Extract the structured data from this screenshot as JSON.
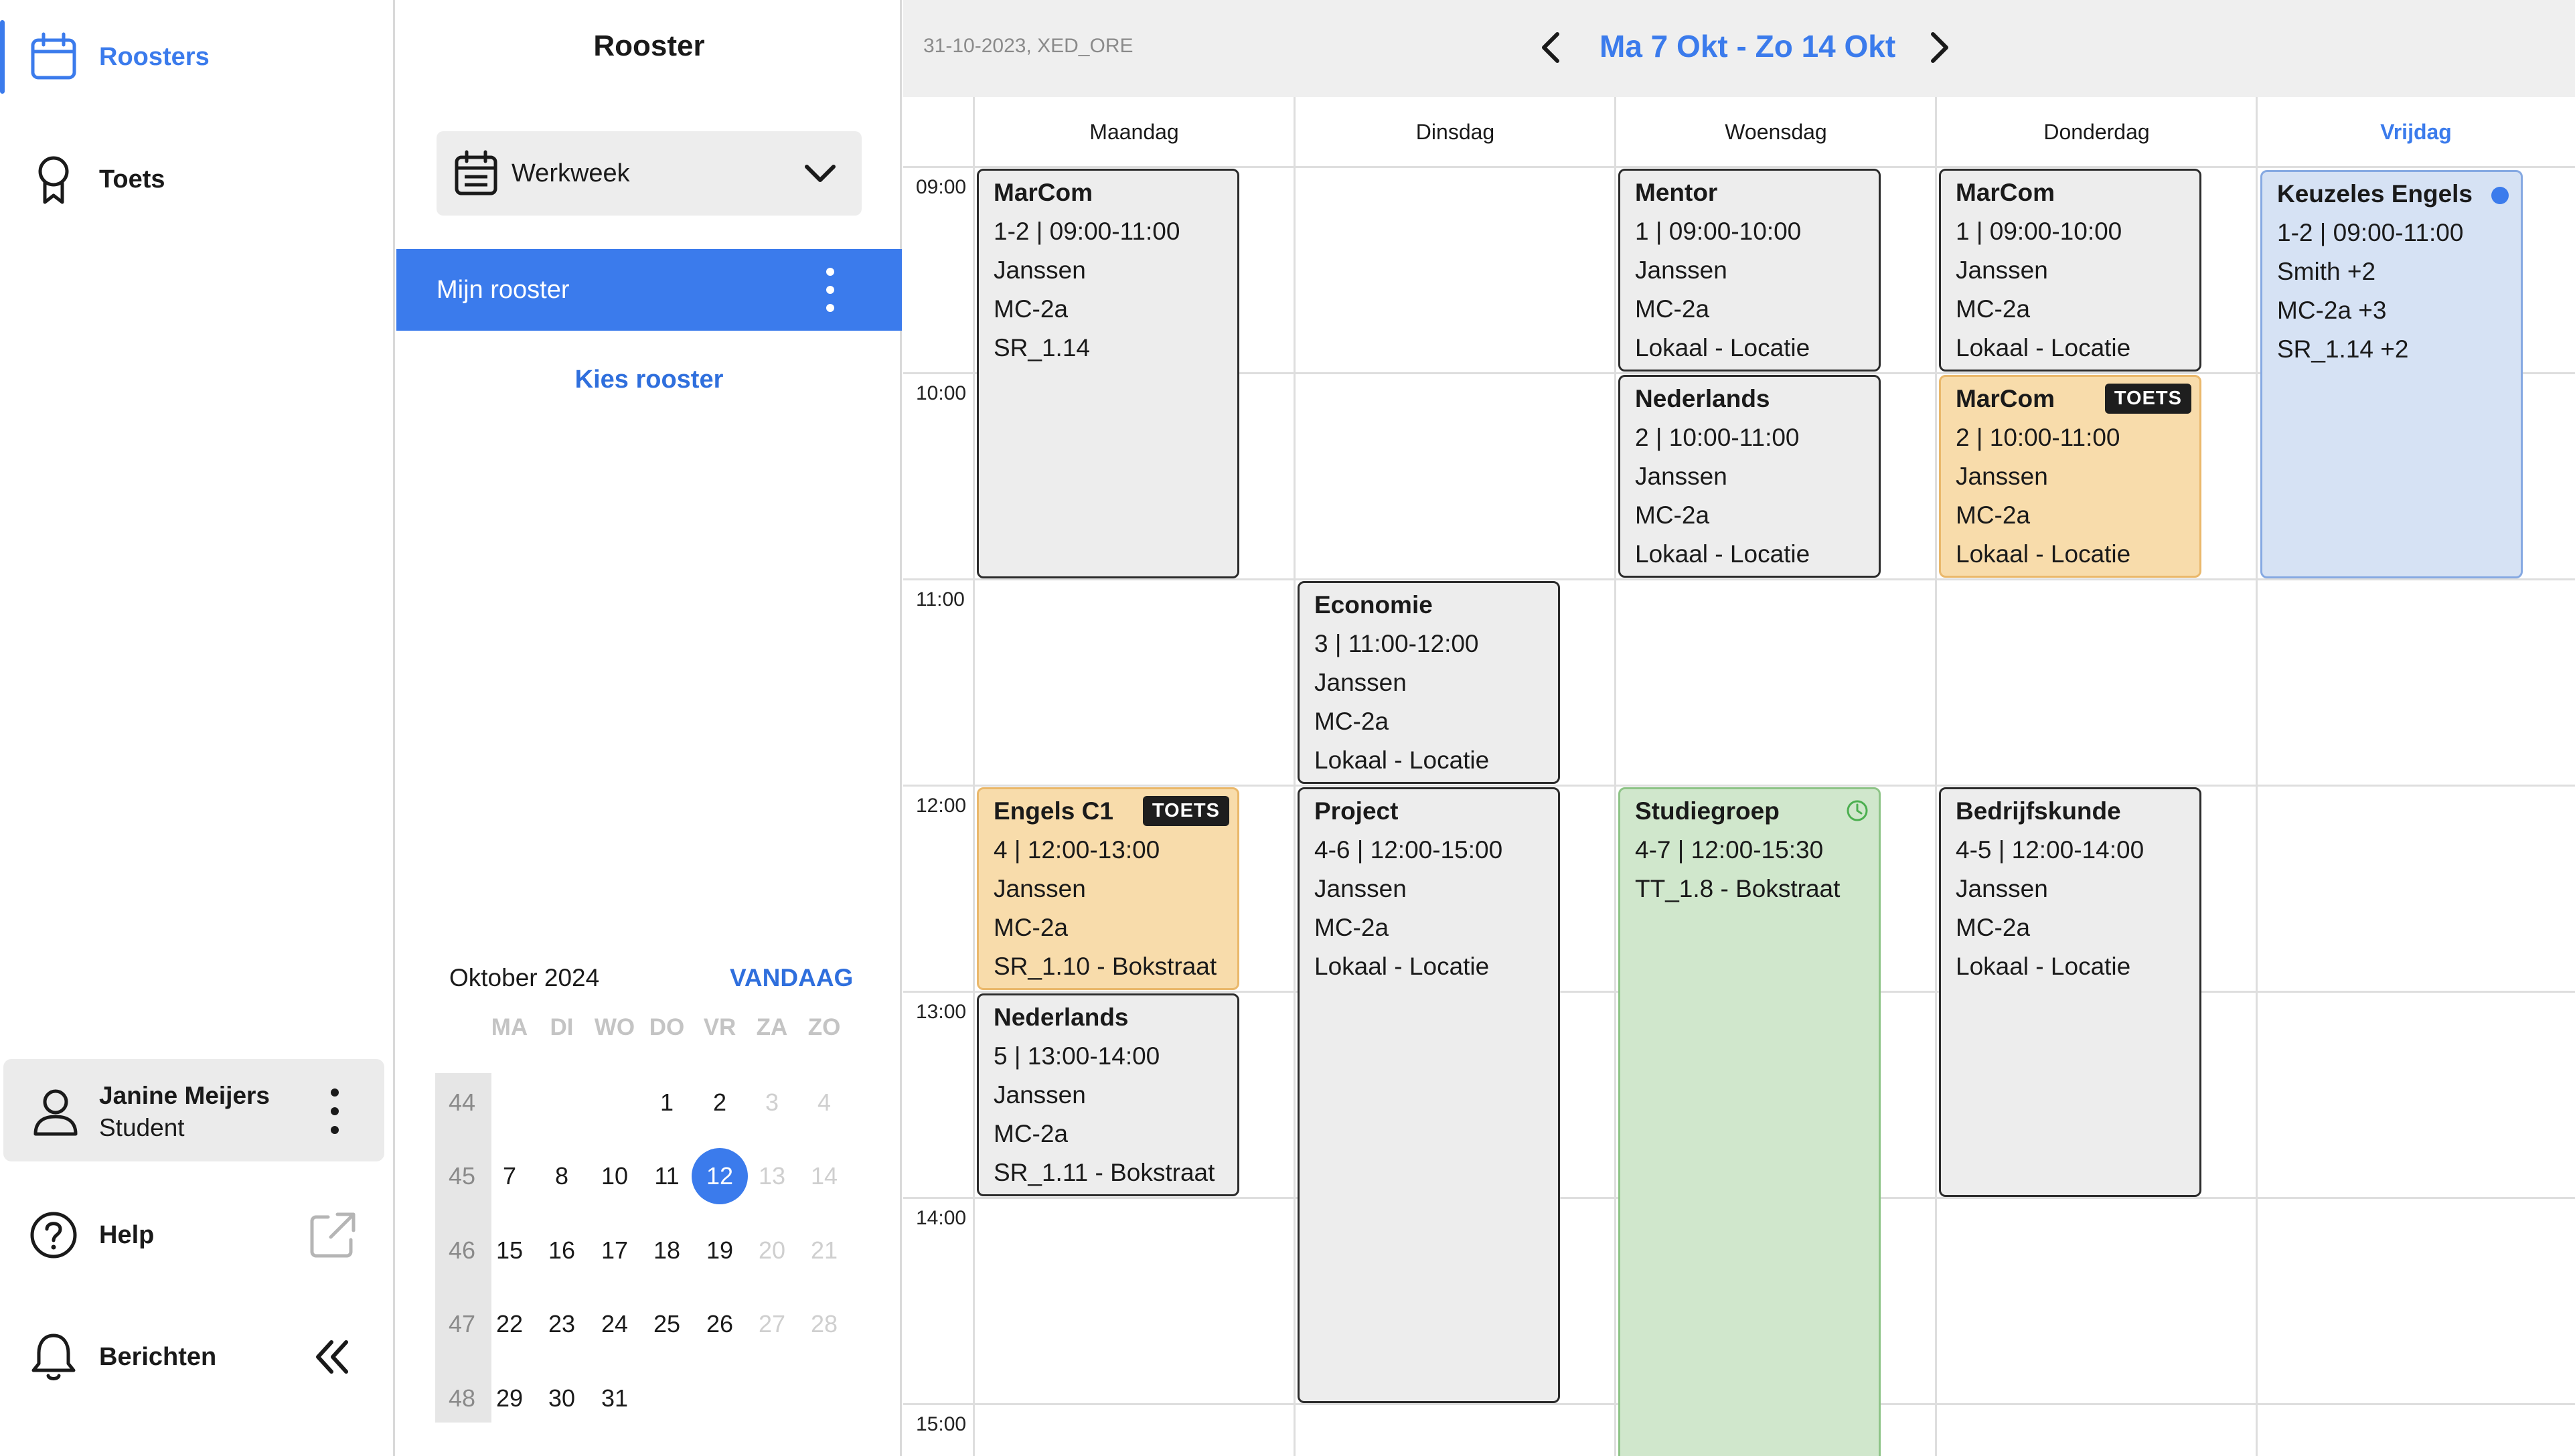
{
  "nav": {
    "roosters": "Roosters",
    "toets": "Toets",
    "user_name": "Janine Meijers",
    "user_role": "Student",
    "help": "Help",
    "berichten": "Berichten"
  },
  "panel": {
    "title": "Rooster",
    "view_select": "Werkweek",
    "my_schedule": "Mijn rooster",
    "choose_schedule": "Kies rooster"
  },
  "mini_calendar": {
    "month": "Oktober 2024",
    "today": "VANDAAG",
    "weekdays": [
      "MA",
      "DI",
      "WO",
      "DO",
      "VR",
      "ZA",
      "ZO"
    ],
    "weeks": [
      {
        "nr": "44",
        "days": [
          "",
          "",
          "",
          "1",
          "2",
          "3",
          "4"
        ]
      },
      {
        "nr": "45",
        "days": [
          "7",
          "8",
          "10",
          "11",
          "12",
          "13",
          "14"
        ]
      },
      {
        "nr": "46",
        "days": [
          "15",
          "16",
          "17",
          "18",
          "19",
          "20",
          "21"
        ]
      },
      {
        "nr": "47",
        "days": [
          "22",
          "23",
          "24",
          "25",
          "26",
          "27",
          "28"
        ]
      },
      {
        "nr": "48",
        "days": [
          "29",
          "30",
          "31",
          "",
          "",
          "",
          ""
        ]
      }
    ],
    "selected": "12"
  },
  "header": {
    "date_info": "31-10-2023, XED_ORE",
    "range": "Ma 7 Okt - Zo 14 Okt"
  },
  "days": [
    "Maandag",
    "Dinsdag",
    "Woensdag",
    "Donderdag",
    "Vrijdag"
  ],
  "times": [
    "09:00",
    "10:00",
    "11:00",
    "12:00",
    "13:00",
    "14:00",
    "15:00"
  ],
  "colors": {
    "accent": "#3b7bec",
    "toets": "#f8dcab",
    "studiegroep": "#d0e7cc",
    "keuze": "#d6e2f4",
    "default": "#ededed"
  },
  "events": {
    "mon_marcom": {
      "title": "MarCom",
      "l1": "1-2 | 09:00-11:00",
      "l2": "Janssen",
      "l3": "MC-2a",
      "l4": "SR_1.14"
    },
    "mon_engels": {
      "title": "Engels C1",
      "badge": "TOETS",
      "l1": "4 | 12:00-13:00",
      "l2": "Janssen",
      "l3": "MC-2a",
      "l4": "SR_1.10 - Bokstraat"
    },
    "mon_nederlands": {
      "title": "Nederlands",
      "l1": "5 | 13:00-14:00",
      "l2": "Janssen",
      "l3": "MC-2a",
      "l4": "SR_1.11 - Bokstraat"
    },
    "tue_economie": {
      "title": "Economie",
      "l1": "3 | 11:00-12:00",
      "l2": "Janssen",
      "l3": "MC-2a",
      "l4": "Lokaal - Locatie"
    },
    "tue_project": {
      "title": "Project",
      "l1": "4-6 | 12:00-15:00",
      "l2": "Janssen",
      "l3": "MC-2a",
      "l4": "Lokaal - Locatie"
    },
    "wed_mentor": {
      "title": "Mentor",
      "l1": "1 | 09:00-10:00",
      "l2": "Janssen",
      "l3": "MC-2a",
      "l4": "Lokaal - Locatie"
    },
    "wed_nederlands": {
      "title": "Nederlands",
      "l1": "2 | 10:00-11:00",
      "l2": "Janssen",
      "l3": "MC-2a",
      "l4": "Lokaal - Locatie"
    },
    "wed_studiegroep": {
      "title": "Studiegroep",
      "l1": "4-7 | 12:00-15:30",
      "l2": "TT_1.8 - Bokstraat"
    },
    "thu_marcom1": {
      "title": "MarCom",
      "l1": "1 | 09:00-10:00",
      "l2": "Janssen",
      "l3": "MC-2a",
      "l4": "Lokaal - Locatie"
    },
    "thu_marcom2": {
      "title": "MarCom",
      "badge": "TOETS",
      "l1": "2 | 10:00-11:00",
      "l2": "Janssen",
      "l3": "MC-2a",
      "l4": "Lokaal - Locatie"
    },
    "thu_bedrijfskunde": {
      "title": "Bedrijfskunde",
      "l1": "4-5 | 12:00-14:00",
      "l2": "Janssen",
      "l3": "MC-2a",
      "l4": "Lokaal - Locatie"
    },
    "fri_engels": {
      "title": "Keuzeles Engels",
      "l1": "1-2 | 09:00-11:00",
      "l2": "Smith +2",
      "l3": "MC-2a +3",
      "l4": "SR_1.14 +2"
    }
  }
}
